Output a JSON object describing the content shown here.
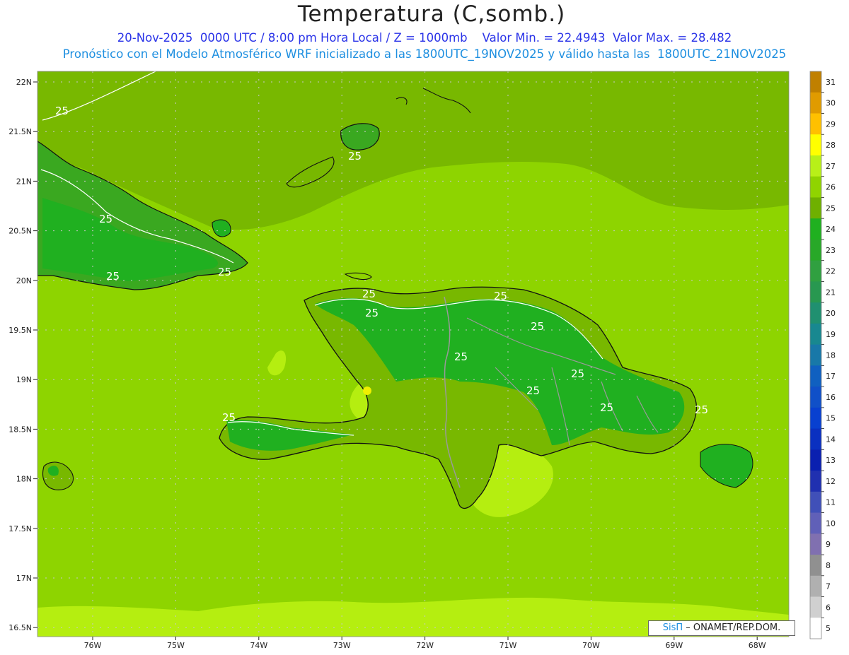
{
  "title": "Temperatura (C,somb.)",
  "subtitle_line1": "20-Nov-2025  0000 UTC / 8:00 pm Hora Local / Z = 1000mb    Valor Min. = 22.4943  Valor Max. = 28.482",
  "subtitle_line2": "Pronóstico con el Modelo Atmosférico WRF inicializado a las 1800UTC_19NOV2025 y válido hasta las  1800UTC_21NOV2025",
  "credit": {
    "brand": "SisΠ",
    "text": " – ONAMET/REP.DOM."
  },
  "lat_labels": [
    "22N",
    "21.5N",
    "21N",
    "20.5N",
    "20N",
    "19.5N",
    "19N",
    "18.5N",
    "18N",
    "17.5N",
    "17N",
    "16.5N"
  ],
  "lon_labels": [
    "76W",
    "75W",
    "74W",
    "73W",
    "72W",
    "71W",
    "70W",
    "69W",
    "68W"
  ],
  "contour_labels": [
    "25",
    "25",
    "25",
    "25",
    "25",
    "25",
    "25",
    "25",
    "25",
    "25",
    "25",
    "25",
    "25",
    "25",
    "25"
  ],
  "colorbar": {
    "values": [
      "31",
      "30",
      "29",
      "28",
      "27",
      "26",
      "25",
      "24",
      "23",
      "22",
      "21",
      "20",
      "19",
      "18",
      "17",
      "16",
      "15",
      "14",
      "13",
      "12",
      "11",
      "10",
      "9",
      "8",
      "7",
      "6",
      "5"
    ],
    "colors": [
      "#c08000",
      "#e09b00",
      "#ffc000",
      "#ffff00",
      "#b8f018",
      "#90d400",
      "#6fb000",
      "#20b020",
      "#28a828",
      "#30a040",
      "#289850",
      "#209070",
      "#188890",
      "#1878a8",
      "#1060c0",
      "#1050c8",
      "#0840d0",
      "#0a30c0",
      "#0a20b0",
      "#2030b0",
      "#4050b8",
      "#6060b8",
      "#8070b0",
      "#909090",
      "#b0b0b0",
      "#d0d0d0",
      "#ffffff"
    ]
  }
}
